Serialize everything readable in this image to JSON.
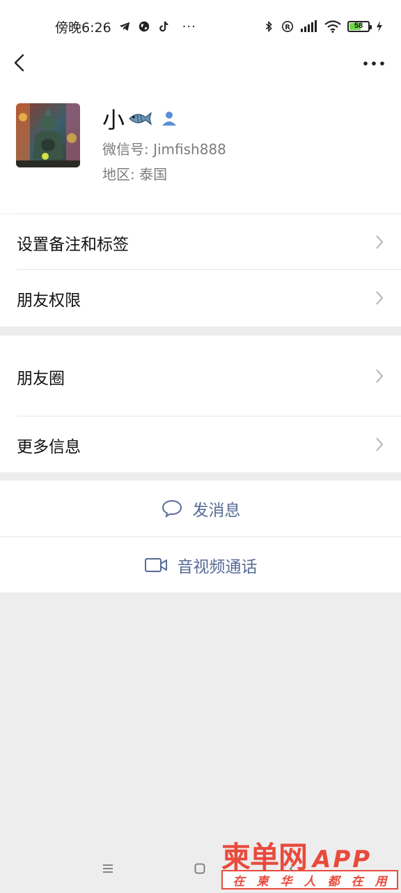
{
  "status_bar": {
    "time": "傍晚6:26",
    "more": "···",
    "battery": "58"
  },
  "profile": {
    "name": "小",
    "wechat_id": "微信号: Jimfish888",
    "region": "地区: 泰国"
  },
  "menu_group1": [
    {
      "label": "设置备注和标签"
    },
    {
      "label": "朋友权限"
    }
  ],
  "menu_group2": [
    {
      "label": "朋友圈"
    },
    {
      "label": "更多信息"
    }
  ],
  "actions": {
    "message": "发消息",
    "call": "音视频通话"
  },
  "watermark": {
    "name": "柬单网",
    "app": "APP",
    "slogan": [
      "在",
      "柬",
      "华",
      "人",
      "都",
      "在",
      "用"
    ]
  },
  "colors": {
    "link_blue": "#576b95",
    "background": "#ededed",
    "watermark_red": "#e84a3c"
  }
}
